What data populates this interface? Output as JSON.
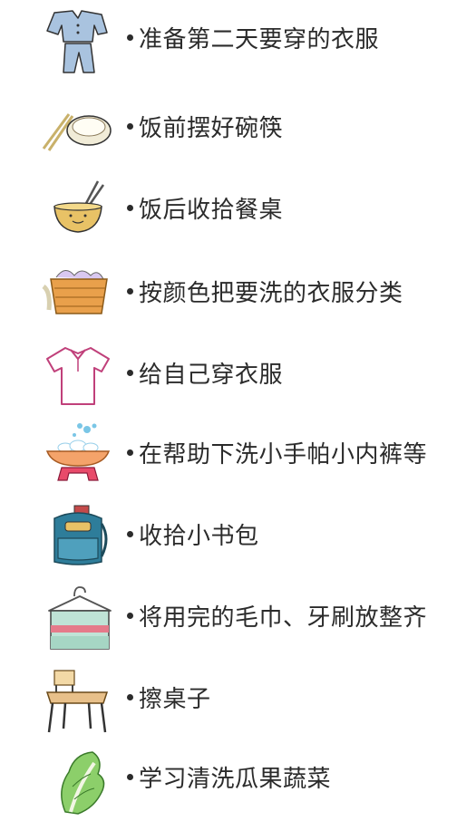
{
  "items": [
    {
      "icon": "clothes-icon",
      "text": "准备第二天要穿的衣服"
    },
    {
      "icon": "bowl-chopsticks-icon",
      "text": "饭前摆好碗筷"
    },
    {
      "icon": "bowl-with-chopsticks-icon",
      "text": "饭后收拾餐桌"
    },
    {
      "icon": "laundry-basket-icon",
      "text": "按颜色把要洗的衣服分类"
    },
    {
      "icon": "shirt-icon",
      "text": "给自己穿衣服"
    },
    {
      "icon": "washbasin-icon",
      "text": "在帮助下洗小手帕小内裤等"
    },
    {
      "icon": "schoolbag-icon",
      "text": "收拾小书包"
    },
    {
      "icon": "towel-hanger-icon",
      "text": "将用完的毛巾、牙刷放整齐"
    },
    {
      "icon": "desk-icon",
      "text": "擦桌子"
    },
    {
      "icon": "vegetable-icon",
      "text": "学习清洗瓜果蔬菜"
    }
  ]
}
